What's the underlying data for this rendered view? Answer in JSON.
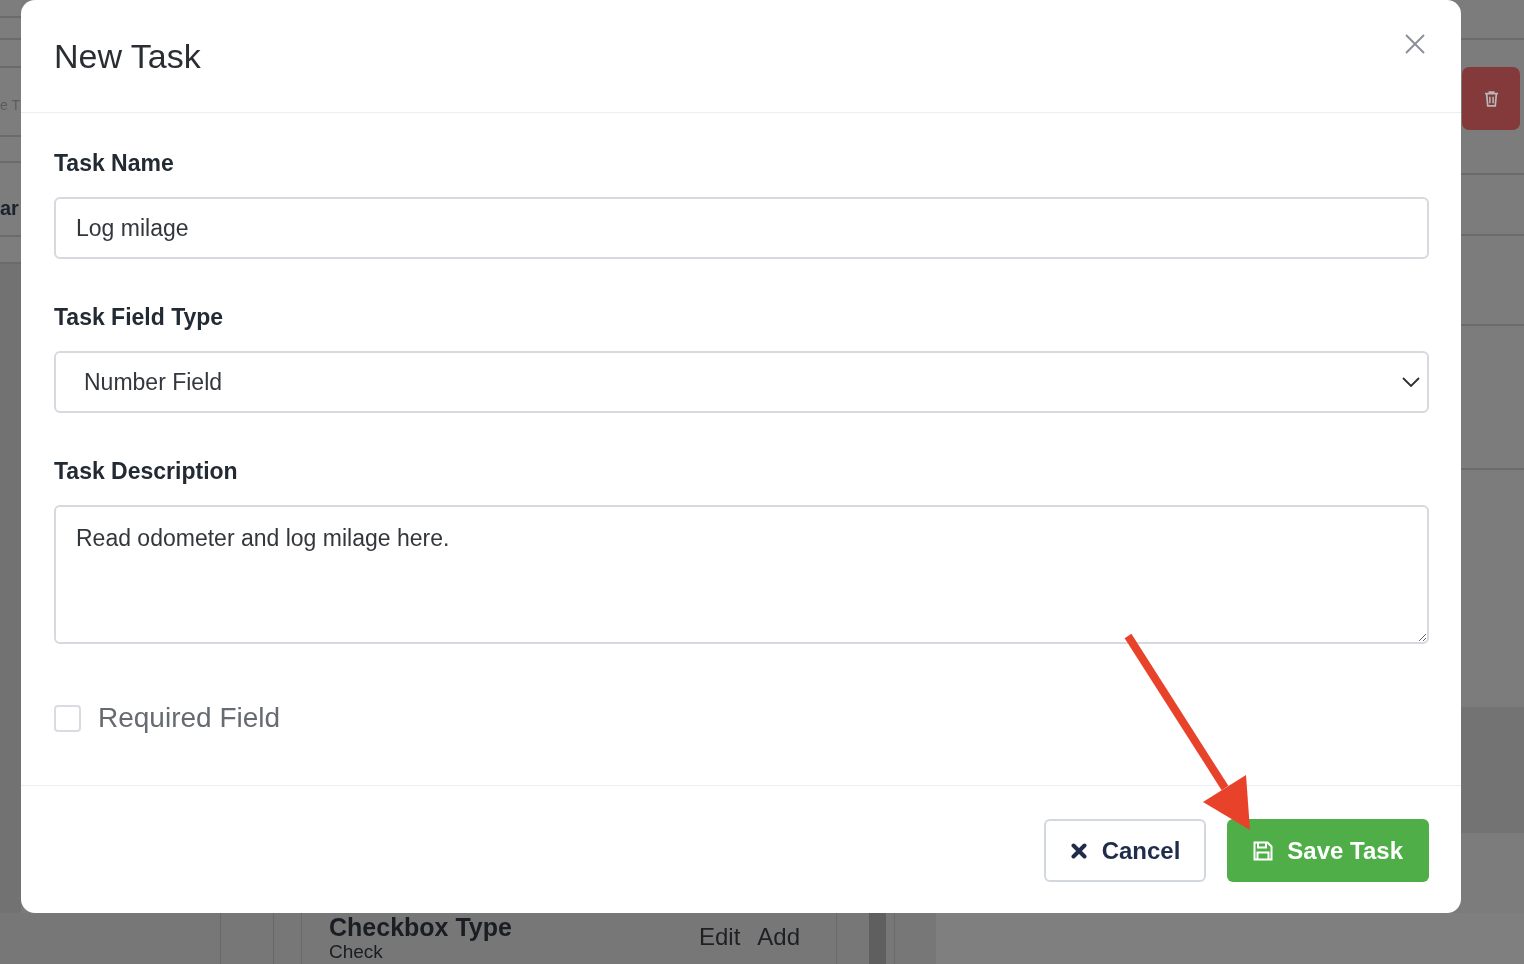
{
  "background": {
    "fragments": [
      {
        "kind": "muted",
        "text": "e T"
      },
      {
        "kind": "bold",
        "text": "ar"
      }
    ],
    "card": {
      "title": "Checkbox Type",
      "subtitle": "Check",
      "actions": [
        "Edit",
        "Add"
      ]
    }
  },
  "modal": {
    "title": "New Task",
    "fields": [
      {
        "kind": "text",
        "label": "Task Name",
        "value": "Log milage"
      },
      {
        "kind": "select",
        "label": "Task Field Type",
        "value": "Number Field"
      },
      {
        "kind": "textarea",
        "label": "Task Description",
        "value": "Read odometer and log milage here."
      }
    ],
    "checkbox": {
      "label": "Required Field",
      "checked": false
    },
    "buttons": [
      {
        "kind": "cancel",
        "label": "Cancel"
      },
      {
        "kind": "save",
        "label": "Save Task"
      }
    ]
  }
}
